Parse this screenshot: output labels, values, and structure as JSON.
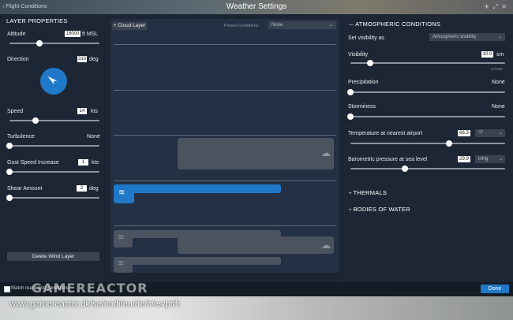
{
  "window": {
    "title": "Weather Settings",
    "back_label": "Flight Conditions",
    "icons": [
      "flight-icon",
      "fullscreen-icon",
      "close-icon"
    ]
  },
  "left": {
    "section_title": "LAYER PROPERTIES",
    "altitude": {
      "label": "Altitude",
      "value": "18000",
      "unit": "ft MSL",
      "fraction": 0.33
    },
    "direction": {
      "label": "Direction",
      "value": "310",
      "unit": "deg",
      "angle_deg": 310
    },
    "speed": {
      "label": "Speed",
      "value": "14",
      "unit": "kts",
      "fraction": 0.29
    },
    "turbulence": {
      "label": "Turbulence",
      "value": "None",
      "fraction": 0.0
    },
    "gust": {
      "label": "Gust Speed Increase",
      "value": "1",
      "unit": "kts",
      "fraction": 0.0
    },
    "shear": {
      "label": "Shear Amount",
      "value": "2",
      "unit": "deg",
      "fraction": 0.0
    },
    "delete_button": "Delete Wind Layer"
  },
  "center": {
    "cloud_layer_button": "+ Cloud Layer",
    "preset_label": "Preset Conditions",
    "preset_value": "None"
  },
  "right": {
    "section_title": "ATMOSPHERIC CONDITIONS",
    "visibility_as": {
      "label": "Set visibility as",
      "value": "Atmospheric visibility"
    },
    "visibility": {
      "label": "Visibility",
      "value": "10.0",
      "unit": "sm",
      "note": "CAVOK",
      "fraction": 0.13
    },
    "precipitation": {
      "label": "Precipitation",
      "value": "None",
      "fraction": 0.0
    },
    "storminess": {
      "label": "Storminess",
      "value": "None",
      "fraction": 0.0
    },
    "temperature": {
      "label": "Temperature at nearest airport",
      "value": "66.3",
      "unit": "°F",
      "fraction": 0.64
    },
    "pressure": {
      "label": "Barometric pressure at sea level",
      "value": "29.9",
      "unit": "inHg",
      "fraction": 0.35
    },
    "thermals": "THERMALS",
    "bodies_of_water": "BODIES OF WATER"
  },
  "bottom": {
    "match_label": "Match real world conditions",
    "done_label": "Done"
  },
  "watermark": {
    "brand": "GAMEREACTOR",
    "url": "www.gamereactor.dk/se/no/fi/eu/de/it/es/pt/fr"
  },
  "colors": {
    "accent": "#1f78c8",
    "panel": "#1d2634",
    "center": "#243043"
  }
}
